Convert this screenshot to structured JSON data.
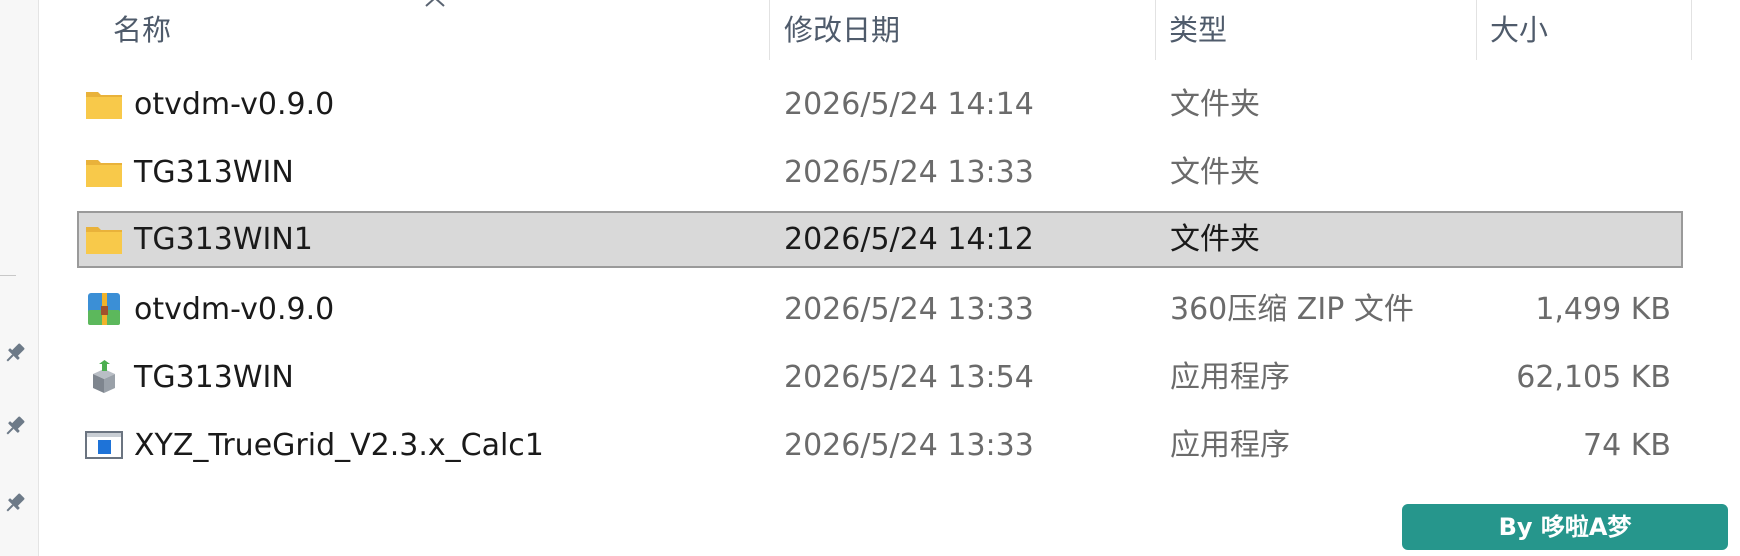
{
  "columns": {
    "name": "名称",
    "date": "修改日期",
    "type": "类型",
    "size": "大小"
  },
  "sort": {
    "column": "name",
    "direction": "ascending",
    "icon": "chevron-up-icon"
  },
  "sidebar": {
    "pins": [
      "pin-icon",
      "pin-icon",
      "pin-icon"
    ]
  },
  "files": [
    {
      "name": "otvdm-v0.9.0",
      "date": "2026/5/24 14:14",
      "type": "文件夹",
      "size": "",
      "icon": "folder-icon",
      "selected": false
    },
    {
      "name": "TG313WIN",
      "date": "2026/5/24 13:33",
      "type": "文件夹",
      "size": "",
      "icon": "folder-icon",
      "selected": false
    },
    {
      "name": "TG313WIN1",
      "date": "2026/5/24 14:12",
      "type": "文件夹",
      "size": "",
      "icon": "folder-icon",
      "selected": true
    },
    {
      "name": "otvdm-v0.9.0",
      "date": "2026/5/24 13:33",
      "type": "360压缩 ZIP 文件",
      "size": "1,499 KB",
      "icon": "zip-archive-icon",
      "selected": false
    },
    {
      "name": "TG313WIN",
      "date": "2026/5/24 13:54",
      "type": "应用程序",
      "size": "62,105 KB",
      "icon": "installer-icon",
      "selected": false
    },
    {
      "name": "XYZ_TrueGrid_V2.3.x_Calc1",
      "date": "2026/5/24 13:33",
      "type": "应用程序",
      "size": "74 KB",
      "icon": "application-window-icon",
      "selected": false
    }
  ],
  "watermark": {
    "text": "By 哆啦A梦",
    "color": "#26968c"
  },
  "colors": {
    "selection_bg": "#d9d9d9",
    "selection_border": "#9a9a9a",
    "folder": "#f8c94a"
  }
}
